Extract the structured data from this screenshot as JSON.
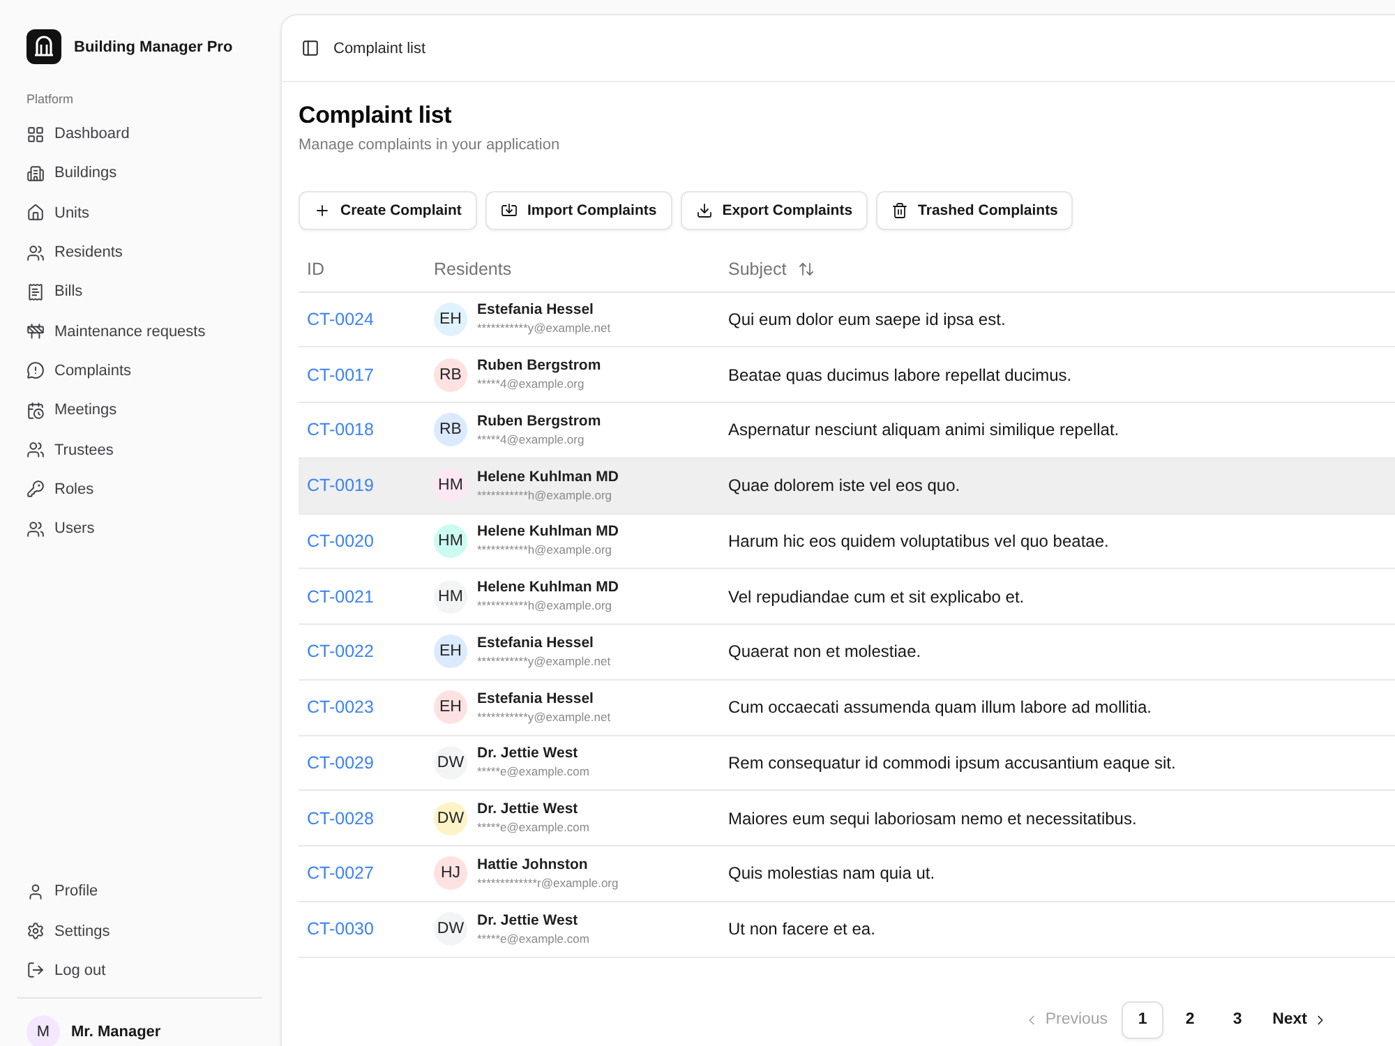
{
  "sidebar": {
    "app_name": "Building Manager Pro",
    "section_label": "Platform",
    "nav_items": [
      "Dashboard",
      "Buildings",
      "Units",
      "Residents",
      "Bills",
      "Maintenance requests",
      "Complaints",
      "Meetings",
      "Trustees",
      "Roles",
      "Users"
    ],
    "footer_items": [
      "Profile",
      "Settings",
      "Log out"
    ],
    "user": {
      "initials": "M",
      "name": "Mr. Manager"
    }
  },
  "header": {
    "breadcrumb": "Complaint list"
  },
  "page": {
    "title": "Complaint list",
    "subtitle": "Manage complaints in your application"
  },
  "actions": [
    "Create Complaint",
    "Import Complaints",
    "Export Complaints",
    "Trashed Complaints"
  ],
  "table": {
    "columns": [
      {
        "label": "ID",
        "sortable": false
      },
      {
        "label": "Residents",
        "sortable": false
      },
      {
        "label": "Subject",
        "sortable": true
      }
    ],
    "rows": [
      {
        "id": "CT-0024",
        "resident": {
          "initials": "EH",
          "name": "Estefania Hessel",
          "email": "***********y@example.net",
          "color": "#e0f2fe"
        },
        "subject": "Qui eum dolor eum saepe id ipsa est.",
        "highlighted": false
      },
      {
        "id": "CT-0017",
        "resident": {
          "initials": "RB",
          "name": "Ruben Bergstrom",
          "email": "*****4@example.org",
          "color": "#fee2e2"
        },
        "subject": "Beatae quas ducimus labore repellat ducimus.",
        "highlighted": false
      },
      {
        "id": "CT-0018",
        "resident": {
          "initials": "RB",
          "name": "Ruben Bergstrom",
          "email": "*****4@example.org",
          "color": "#dbeafe"
        },
        "subject": "Aspernatur nesciunt aliquam animi similique repellat.",
        "highlighted": false
      },
      {
        "id": "CT-0019",
        "resident": {
          "initials": "HM",
          "name": "Helene Kuhlman MD",
          "email": "***********h@example.org",
          "color": "#fce7f3"
        },
        "subject": "Quae dolorem iste vel eos quo.",
        "highlighted": true
      },
      {
        "id": "CT-0020",
        "resident": {
          "initials": "HM",
          "name": "Helene Kuhlman MD",
          "email": "***********h@example.org",
          "color": "#ccfbf1"
        },
        "subject": "Harum hic eos quidem voluptatibus vel quo beatae.",
        "highlighted": false
      },
      {
        "id": "CT-0021",
        "resident": {
          "initials": "HM",
          "name": "Helene Kuhlman MD",
          "email": "***********h@example.org",
          "color": "#f3f4f6"
        },
        "subject": "Vel repudiandae cum et sit explicabo et.",
        "highlighted": false
      },
      {
        "id": "CT-0022",
        "resident": {
          "initials": "EH",
          "name": "Estefania Hessel",
          "email": "***********y@example.net",
          "color": "#dbeafe"
        },
        "subject": "Quaerat non et molestiae.",
        "highlighted": false
      },
      {
        "id": "CT-0023",
        "resident": {
          "initials": "EH",
          "name": "Estefania Hessel",
          "email": "***********y@example.net",
          "color": "#fee2e2"
        },
        "subject": "Cum occaecati assumenda quam illum labore ad mollitia.",
        "highlighted": false
      },
      {
        "id": "CT-0029",
        "resident": {
          "initials": "DW",
          "name": "Dr. Jettie West",
          "email": "*****e@example.com",
          "color": "#f3f4f6"
        },
        "subject": "Rem consequatur id commodi ipsum accusantium eaque sit.",
        "highlighted": false
      },
      {
        "id": "CT-0028",
        "resident": {
          "initials": "DW",
          "name": "Dr. Jettie West",
          "email": "*****e@example.com",
          "color": "#fef3c7"
        },
        "subject": "Maiores eum sequi laboriosam nemo et necessitatibus.",
        "highlighted": false
      },
      {
        "id": "CT-0027",
        "resident": {
          "initials": "HJ",
          "name": "Hattie Johnston",
          "email": "*************r@example.org",
          "color": "#fee2e2"
        },
        "subject": "Quis molestias nam quia ut.",
        "highlighted": false
      },
      {
        "id": "CT-0030",
        "resident": {
          "initials": "DW",
          "name": "Dr. Jettie West",
          "email": "*****e@example.com",
          "color": "#f3f4f6"
        },
        "subject": "Ut non facere et ea.",
        "highlighted": false
      }
    ]
  },
  "pagination": {
    "previous": {
      "label": "Previous",
      "disabled": true
    },
    "pages": [
      {
        "label": "1",
        "selected": true
      },
      {
        "label": "2",
        "selected": false
      },
      {
        "label": "3",
        "selected": false
      }
    ],
    "next": {
      "label": "Next",
      "disabled": false
    }
  }
}
